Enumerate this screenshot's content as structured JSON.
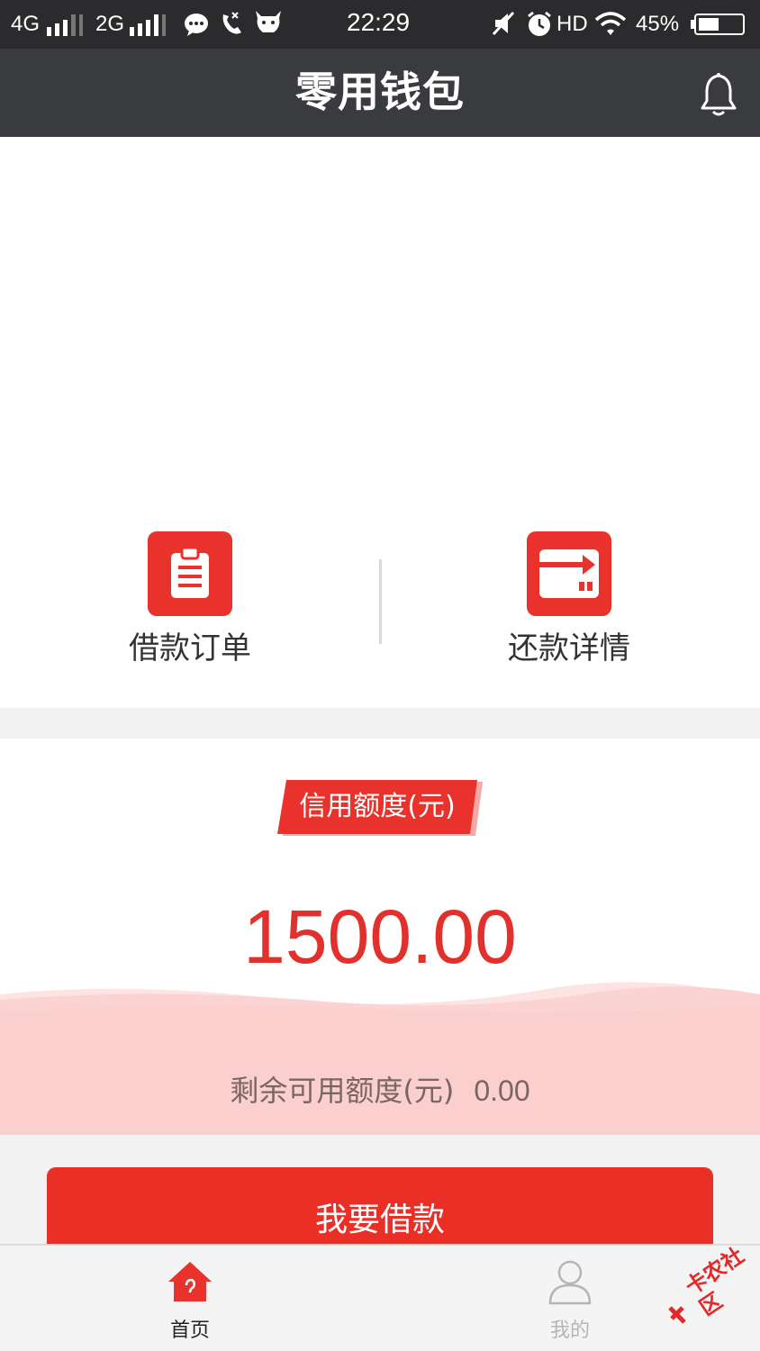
{
  "status_bar": {
    "network_1": "4G",
    "network_2": "2G",
    "time": "22:29",
    "hd": "HD",
    "battery": "45%",
    "left_icons": [
      "chat-bubble-icon",
      "missed-call-icon",
      "cow-app-icon"
    ],
    "right_icons": [
      "mute-icon",
      "alarm-icon",
      "wifi-icon",
      "battery-icon"
    ]
  },
  "header": {
    "title": "零用钱包",
    "notification_icon": "bell-icon"
  },
  "shortcuts": [
    {
      "label": "借款订单",
      "icon": "clipboard-icon"
    },
    {
      "label": "还款详情",
      "icon": "card-transfer-icon"
    }
  ],
  "credit": {
    "tag_label": "信用额度(元)",
    "amount": "1500.00",
    "remaining_label": "剩余可用额度(元)",
    "remaining_value": "0.00"
  },
  "actions": {
    "borrow_label": "我要借款"
  },
  "bottom_nav": [
    {
      "label": "首页",
      "icon": "home-icon",
      "active": true
    },
    {
      "label": "我的",
      "icon": "user-icon",
      "active": false
    }
  ],
  "watermark": {
    "text": "卡农社区"
  },
  "colors": {
    "accent": "#e8322b",
    "header_bg": "#3a3b3e",
    "status_bg": "#2b2b2d",
    "wave_light": "#fbd0cf",
    "nav_active": "#e8322b",
    "nav_inactive": "#b5b5b5"
  }
}
